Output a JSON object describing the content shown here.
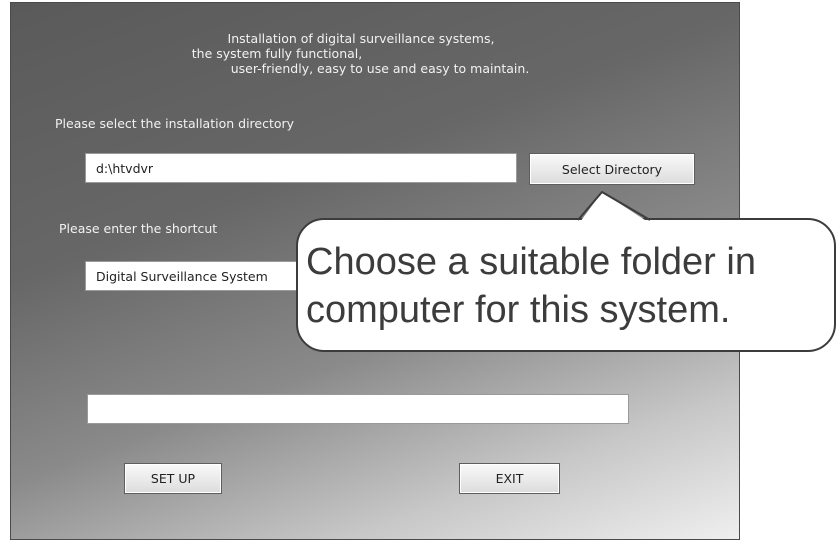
{
  "intro": {
    "line1": "Installation of digital surveillance systems,",
    "line2": "the system fully functional,",
    "line3": "user-friendly, easy to use and easy to maintain."
  },
  "install_dir": {
    "label": "Please select the installation directory",
    "value": "d:\\htvdvr",
    "button_label": "Select Directory"
  },
  "shortcut": {
    "label": "Please enter the shortcut",
    "value": "Digital Surveillance System"
  },
  "progress": {
    "value": 0
  },
  "buttons": {
    "setup_label": "SET UP",
    "exit_label": "EXIT"
  },
  "callout": {
    "line1": "Choose a suitable folder in",
    "line2": "computer for this system."
  }
}
